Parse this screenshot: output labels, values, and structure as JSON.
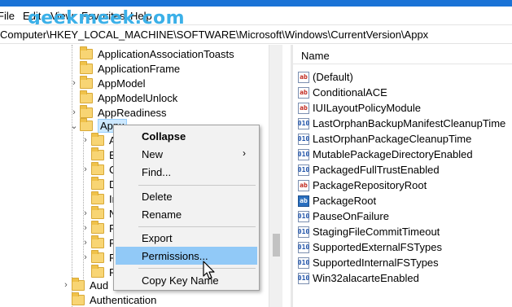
{
  "menubar": {
    "items": [
      "File",
      "Edit",
      "View",
      "Favorites",
      "Help"
    ],
    "watermark": "geekmeek.com"
  },
  "address": {
    "path": "Computer\\HKEY_LOCAL_MACHINE\\SOFTWARE\\Microsoft\\Windows\\CurrentVersion\\Appx"
  },
  "tree": {
    "items": [
      {
        "label": "ApplicationAssociationToasts"
      },
      {
        "label": "ApplicationFrame"
      },
      {
        "label": "AppModel"
      },
      {
        "label": "AppModelUnlock"
      },
      {
        "label": "AppReadiness"
      },
      {
        "label": "Appx"
      },
      {
        "label": "A"
      },
      {
        "label": "B"
      },
      {
        "label": "C"
      },
      {
        "label": "D"
      },
      {
        "label": "In"
      },
      {
        "label": "N"
      },
      {
        "label": "P"
      },
      {
        "label": "P"
      },
      {
        "label": "P"
      },
      {
        "label": "P"
      },
      {
        "label": "Aud"
      },
      {
        "label": "Authentication"
      }
    ]
  },
  "values": {
    "column_name": "Name",
    "items": [
      {
        "name": "(Default)",
        "type": "sz"
      },
      {
        "name": "ConditionalACE",
        "type": "sz"
      },
      {
        "name": "IUILayoutPolicyModule",
        "type": "sz"
      },
      {
        "name": "LastOrphanBackupManifestCleanupTime",
        "type": "dw"
      },
      {
        "name": "LastOrphanPackageCleanupTime",
        "type": "dw"
      },
      {
        "name": "MutablePackageDirectoryEnabled",
        "type": "dw"
      },
      {
        "name": "PackagedFullTrustEnabled",
        "type": "dw"
      },
      {
        "name": "PackageRepositoryRoot",
        "type": "sz"
      },
      {
        "name": "PackageRoot",
        "type": "sel"
      },
      {
        "name": "PauseOnFailure",
        "type": "dw"
      },
      {
        "name": "StagingFileCommitTimeout",
        "type": "dw"
      },
      {
        "name": "SupportedExternalFSTypes",
        "type": "dw"
      },
      {
        "name": "SupportedInternalFSTypes",
        "type": "dw"
      },
      {
        "name": "Win32alacarteEnabled",
        "type": "dw"
      }
    ]
  },
  "context_menu": {
    "collapse": "Collapse",
    "new": "New",
    "find": "Find...",
    "delete": "Delete",
    "rename": "Rename",
    "export": "Export",
    "permissions": "Permissions...",
    "copy_key_name": "Copy Key Name",
    "submenu_arrow": "›"
  },
  "glyphs": {
    "chev_right": "›",
    "chev_down": "⌄",
    "sz_icon": "ab",
    "dw_icon": "010"
  },
  "colors": {
    "highlight": "#91c9f7",
    "selection": "#cce8ff",
    "window_edge": "#1a73d6",
    "watermark": "#3bb0e8"
  }
}
